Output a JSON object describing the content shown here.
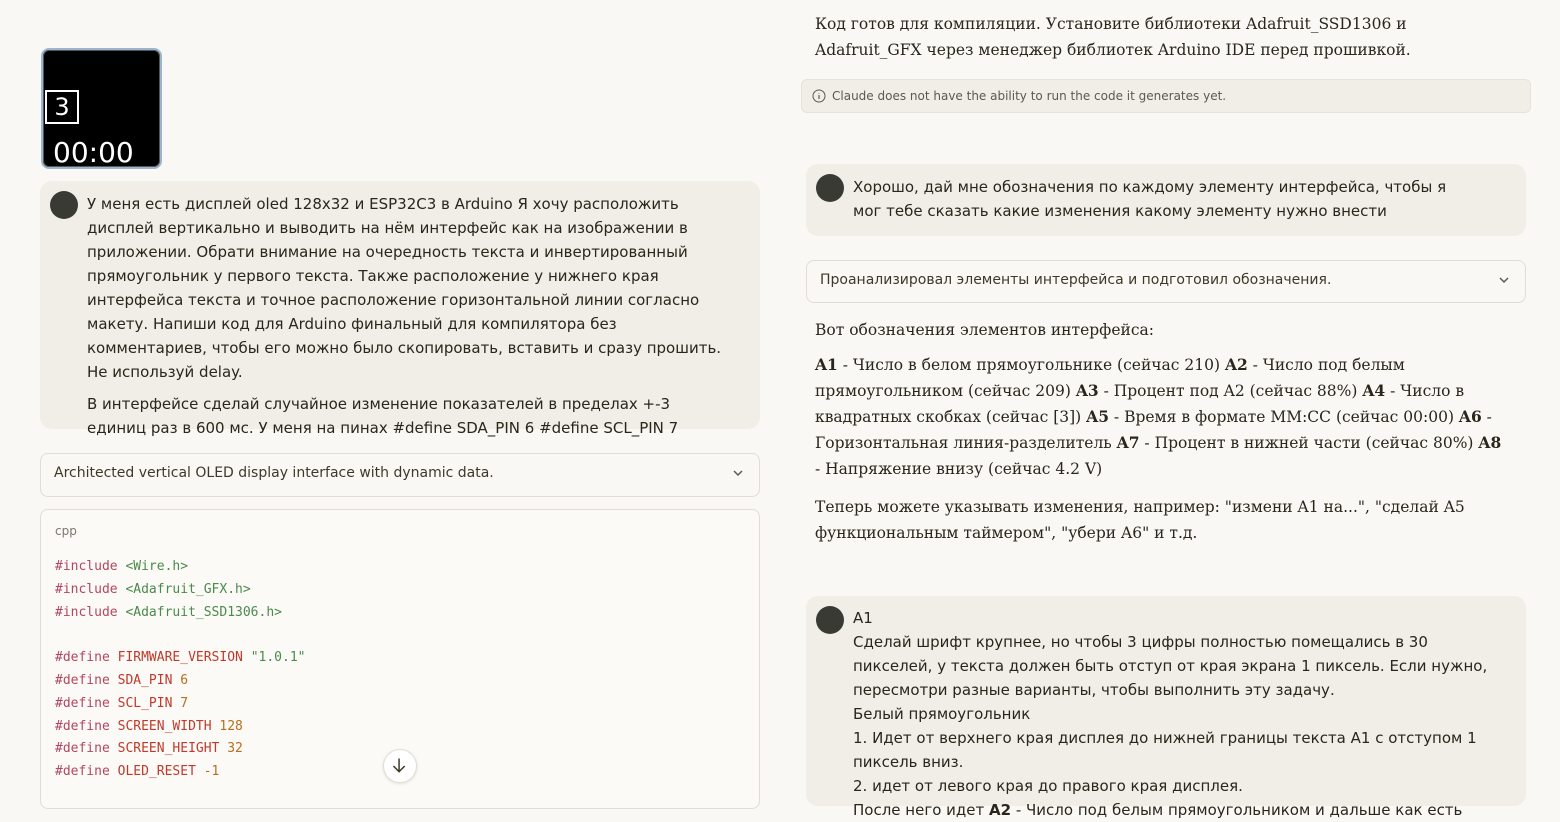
{
  "oled_preview": {
    "box_value": "3",
    "time": "00:00"
  },
  "left": {
    "user_message": {
      "paragraph1": "У меня есть дисплей oled 128x32 и ESP32C3 в Arduino Я хочу расположить дисплей вертикально и выводить на нём интерфейс как на изображении в приложении. Обрати внимание на очередность текста и инвертированный прямоугольник у первого текста. Также расположение у нижнего края интерфейса текста и точное расположение горизонтальной линии согласно макету. Напиши код для Arduino финальный для компилятора без комментариев, чтобы его можно было скопировать, вставить и сразу прошить. Не используй delay.",
      "paragraph2": "В интерфейсе сделай случайное изменение показателей в пределах +-3 единиц раз в 600 мс. У меня на пинах #define SDA_PIN 6 #define SCL_PIN 7"
    },
    "thinking_label": "Architected vertical OLED display interface with dynamic data.",
    "code": {
      "language": "cpp",
      "lines": [
        {
          "kw": "#include",
          "arg": "<Wire.h>",
          "kind": "str"
        },
        {
          "kw": "#include",
          "arg": "<Adafruit_GFX.h>",
          "kind": "str"
        },
        {
          "kw": "#include",
          "arg": "<Adafruit_SSD1306.h>",
          "kind": "str"
        },
        {
          "kw": "",
          "arg": "",
          "kind": "blank"
        },
        {
          "kw": "#define",
          "name": "FIRMWARE_VERSION",
          "arg": "\"1.0.1\"",
          "kind": "str"
        },
        {
          "kw": "#define",
          "name": "SDA_PIN",
          "arg": "6",
          "kind": "num"
        },
        {
          "kw": "#define",
          "name": "SCL_PIN",
          "arg": "7",
          "kind": "num"
        },
        {
          "kw": "#define",
          "name": "SCREEN_WIDTH",
          "arg": "128",
          "kind": "num"
        },
        {
          "kw": "#define",
          "name": "SCREEN_HEIGHT",
          "arg": "32",
          "kind": "num"
        },
        {
          "kw": "#define",
          "name": "OLED_RESET",
          "arg": "-1",
          "kind": "num"
        }
      ]
    }
  },
  "right": {
    "intro_text": "Код готов для компиляции. Установите библиотеки Adafruit_SSD1306 и Adafruit_GFX через менеджер библиотек Arduino IDE перед прошивкой.",
    "notice": "Claude does not have the ability to run the code it generates yet.",
    "user_message2": "Хорошо, дай мне обозначения по каждому элементу интерфейса, чтобы я мог тебе сказать какие изменения какому элементу нужно внести",
    "thinking_label2": "Проанализировал элементы интерфейса и подготовил обозначения.",
    "legend_heading": "Вот обозначения элементов интерфейса:",
    "legend_items": [
      {
        "code": "A1",
        "desc": " - Число в белом прямоугольнике (сейчас 210) "
      },
      {
        "code": "A2",
        "desc": " - Число под белым прямоугольником (сейчас 209) "
      },
      {
        "code": "A3",
        "desc": " - Процент под A2 (сейчас 88%) "
      },
      {
        "code": "A4",
        "desc": " - Число в квадратных скобках (сейчас [3]) "
      },
      {
        "code": "A5",
        "desc": " - Время в формате ММ:СС (сейчас 00:00) "
      },
      {
        "code": "A6",
        "desc": " - Горизонтальная линия-разделитель "
      },
      {
        "code": "A7",
        "desc": " - Процент в нижней части (сейчас 80%) "
      },
      {
        "code": "A8",
        "desc": " - Напряжение внизу (сейчас 4.2 V)"
      }
    ],
    "closing_text": "Теперь можете указывать изменения, например: \"измени A1 на...\", \"сделай A5 функциональным таймером\", \"убери A6\" и т.д.",
    "user_message3": {
      "line1": "A1",
      "line2": "Сделай шрифт крупнее, но чтобы 3 цифры полностью помещались в 30 пикселей, у текста должен быть отступ от края экрана 1 пиксель. Если нужно, пересмотри разные варианты, чтобы выполнить эту задачу.",
      "line3": "Белый прямоугольник",
      "line4": "1. Идет от верхнего края дисплея до нижней границы текста A1 с отступом 1 пиксель вниз.",
      "line5": "2. идет от левого края до правого края дисплея.",
      "line6_prefix": "После него идет ",
      "line6_bold": "A2",
      "line6_suffix": " - Число под белым прямоугольником и дальше как есть"
    }
  }
}
